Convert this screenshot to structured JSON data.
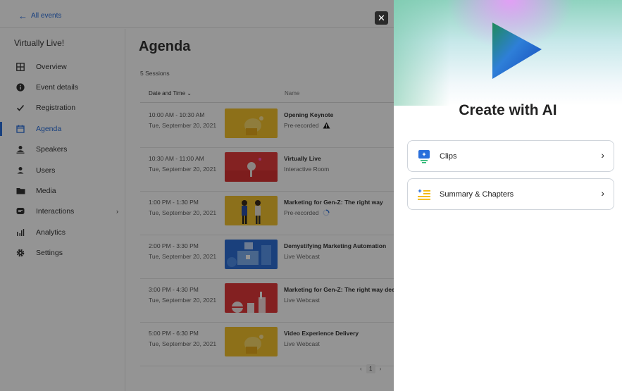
{
  "header": {
    "back_label": "All events",
    "close_symbol": "✕"
  },
  "sidebar": {
    "event_name": "Virtually Live!",
    "items": [
      {
        "label": "Overview",
        "icon": "grid-icon"
      },
      {
        "label": "Event details",
        "icon": "info-icon"
      },
      {
        "label": "Registration",
        "icon": "check-icon"
      },
      {
        "label": "Agenda",
        "icon": "calendar-icon",
        "active": true
      },
      {
        "label": "Speakers",
        "icon": "speaker-icon"
      },
      {
        "label": "Users",
        "icon": "user-icon"
      },
      {
        "label": "Media",
        "icon": "folder-icon"
      },
      {
        "label": "Interactions",
        "icon": "chat-icon",
        "has_submenu": true
      },
      {
        "label": "Analytics",
        "icon": "bar-chart-icon"
      },
      {
        "label": "Settings",
        "icon": "gear-icon"
      }
    ]
  },
  "main": {
    "title": "Agenda",
    "session_count": "5 Sessions",
    "columns": {
      "date_time": "Date and Time",
      "name": "Name"
    },
    "rows": [
      {
        "time": "10:00 AM - 10:30 AM",
        "date": "Tue, September 20, 2021",
        "title": "Opening Keynote",
        "subtitle": "Pre-recorded",
        "status_icon": "warning-icon",
        "thumb": "yellow"
      },
      {
        "time": "10:30 AM - 11:00 AM",
        "date": "Tue, September 20, 2021",
        "title": "Virtually Live",
        "subtitle": "Interactive Room",
        "status_icon": "",
        "thumb": "red"
      },
      {
        "time": "1:00 PM - 1:30 PM",
        "date": "Tue, September 20, 2021",
        "title": "Marketing for Gen-Z: The right way",
        "subtitle": "Pre-recorded",
        "status_icon": "loading-icon",
        "thumb": "yellow-people"
      },
      {
        "time": "2:00 PM - 3:30 PM",
        "date": "Tue, September 20, 2021",
        "title": "Demystifying Marketing Automation",
        "subtitle": "Live Webcast",
        "status_icon": "",
        "thumb": "blue"
      },
      {
        "time": "3:00 PM - 4:30 PM",
        "date": "Tue, September 20, 2021",
        "title": "Marketing for Gen-Z: The right way deep",
        "subtitle": "Live Webcast",
        "status_icon": "",
        "thumb": "red-shapes"
      },
      {
        "time": "5:00 PM - 6:30 PM",
        "date": "Tue, September 20, 2021",
        "title": "Video Experience Delivery",
        "subtitle": "Live Webcast",
        "status_icon": "",
        "thumb": "yellow"
      }
    ],
    "pagination": {
      "prev": "‹",
      "page": "1",
      "next": "›"
    }
  },
  "ai_panel": {
    "title": "Create with AI",
    "options": [
      {
        "label": "Clips",
        "icon": "clips-icon"
      },
      {
        "label": "Summary & Chapters",
        "icon": "summary-icon"
      }
    ]
  },
  "colors": {
    "accent": "#2a6fdb",
    "overlay": "rgba(0,0,0,0.42)"
  }
}
